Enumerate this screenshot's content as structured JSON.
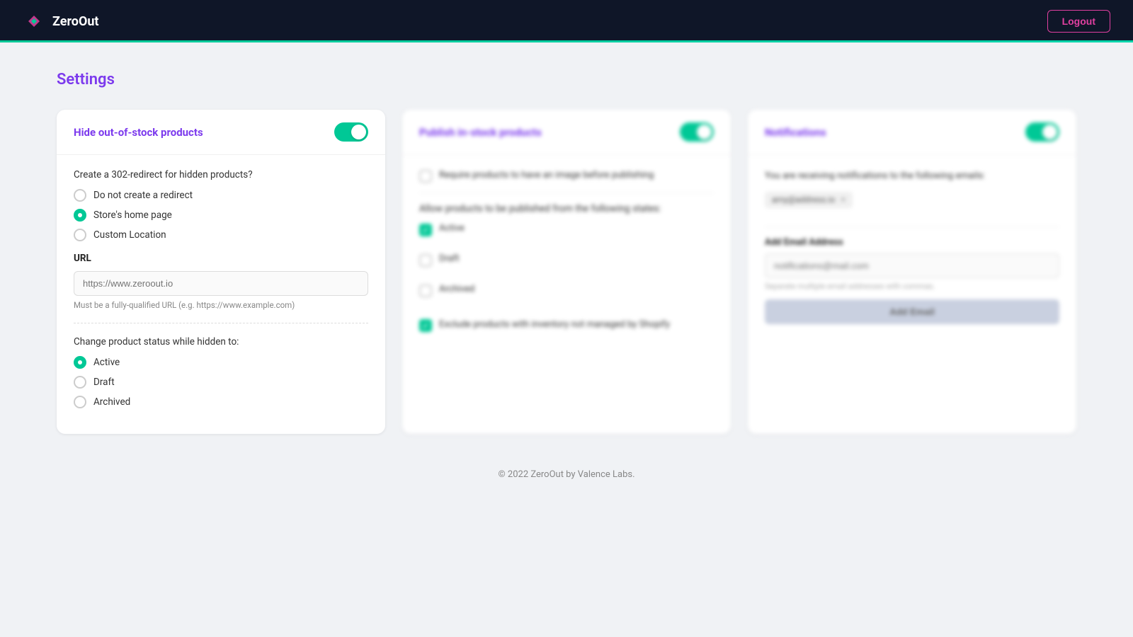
{
  "header": {
    "logo_text": "ZeroOut",
    "logout_label": "Logout"
  },
  "page": {
    "title": "Settings",
    "footer": "© 2022 ZeroOut by Valence Labs."
  },
  "card1": {
    "title": "Hide out-of-stock products",
    "toggle_on": true,
    "redirect_question": "Create a 302-redirect for hidden products?",
    "redirect_options": [
      {
        "label": "Do not create a redirect",
        "selected": false
      },
      {
        "label": "Store's home page",
        "selected": true
      },
      {
        "label": "Custom Location",
        "selected": false
      }
    ],
    "url_label": "URL",
    "url_placeholder": "https://www.zeroout.io",
    "url_hint": "Must be a fully-qualified URL (e.g. https://www.example.com)",
    "status_label": "Change product status while hidden to:",
    "status_options": [
      {
        "label": "Active",
        "selected": true
      },
      {
        "label": "Draft",
        "selected": false
      },
      {
        "label": "Archived",
        "selected": false
      }
    ]
  },
  "card2": {
    "title": "Publish in-stock products",
    "toggle_on": true,
    "require_image_label": "Require products to have an image before publishing",
    "require_image_checked": false,
    "states_label": "Allow products to be published from the following states:",
    "states": [
      {
        "label": "Active",
        "checked": true
      },
      {
        "label": "Draft",
        "checked": false
      },
      {
        "label": "Archived",
        "checked": false
      }
    ],
    "exclude_label": "Exclude products with inventory not managed by Shopify",
    "exclude_checked": true
  },
  "card3": {
    "title": "Notifications",
    "toggle_on": true,
    "receiving_text": "You are receiving notifications to the following emails:",
    "email_tag": "amy@address.io",
    "add_email_label": "Add Email Address",
    "email_placeholder": "notifications@mail.com",
    "email_hint": "Separate multiple email addresses with commas.",
    "add_email_btn": "Add Email"
  }
}
